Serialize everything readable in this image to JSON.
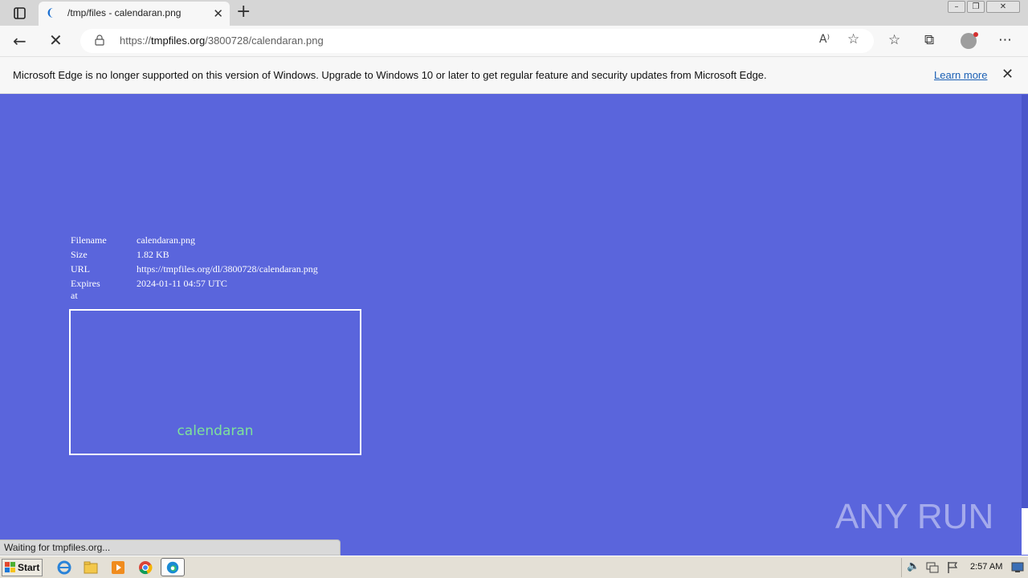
{
  "browser": {
    "tab": {
      "title": "/tmp/files - calendaran.png"
    },
    "url": {
      "prefix": "https://",
      "host": "tmpfiles.org",
      "path": "/3800728/calendaran.png"
    },
    "infobar": {
      "message": "Microsoft Edge is no longer supported on this version of Windows. Upgrade to Windows 10 or later to get regular feature and security updates from Microsoft Edge.",
      "link": "Learn more"
    },
    "status": "Waiting for tmpfiles.org..."
  },
  "file": {
    "rows": [
      {
        "key": "Filename",
        "value": "calendaran.png"
      },
      {
        "key": "Size",
        "value": "1.82 KB"
      },
      {
        "key": "URL",
        "value": "https://tmpfiles.org/dl/3800728/calendaran.png"
      },
      {
        "key": "Expires at",
        "value": "2024-01-11 04:57 UTC"
      }
    ],
    "preview_caption": "calendaran"
  },
  "watermark": {
    "text": "ANY RUN"
  },
  "taskbar": {
    "start_label": "Start",
    "clock": "2:57 AM"
  },
  "colors": {
    "page_bg": "#5a65dc",
    "caption": "#7ee29a"
  },
  "icons": [
    "tab-actions-icon",
    "edge-loading-icon",
    "close-icon",
    "plus-icon",
    "back-arrow-icon",
    "stop-icon",
    "lock-icon",
    "read-aloud-icon",
    "add-favorite-icon",
    "favorites-icon",
    "collections-icon",
    "profile-avatar-icon",
    "more-menu-icon",
    "windows-flag-icon",
    "ie-icon",
    "explorer-icon",
    "media-player-icon",
    "chrome-icon",
    "edge-icon",
    "volume-icon",
    "network-icon",
    "action-center-flag-icon",
    "show-desktop-icon"
  ]
}
